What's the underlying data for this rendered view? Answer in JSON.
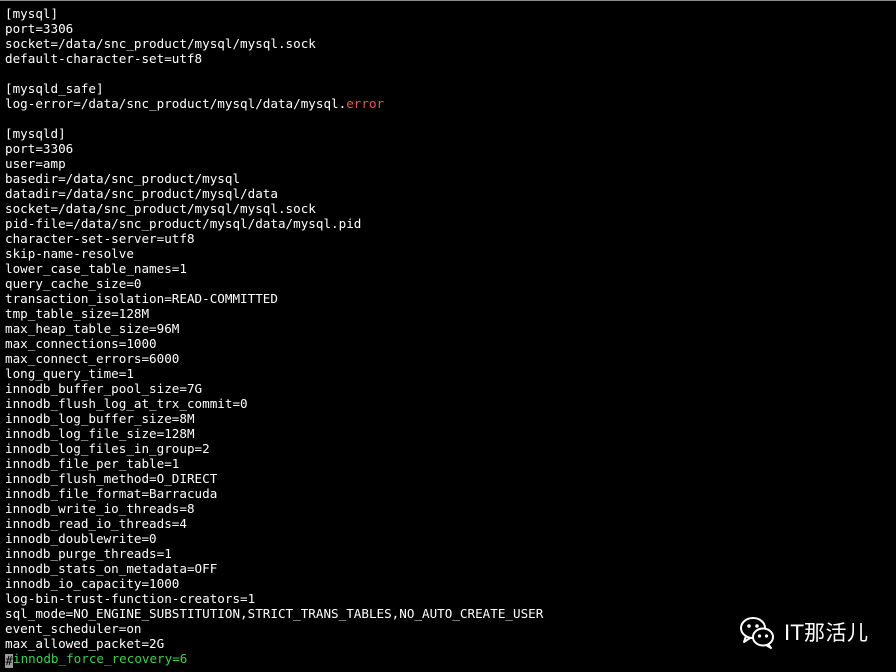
{
  "editor": {
    "lines": [
      "[mysql]",
      "port=3306",
      "socket=/data/snc_product/mysql/mysql.sock",
      "default-character-set=utf8",
      "",
      "[mysqld_safe]",
      "log-error=/data/snc_product/mysql/data/mysql.",
      "",
      "[mysqld]",
      "port=3306",
      "user=amp",
      "basedir=/data/snc_product/mysql",
      "datadir=/data/snc_product/mysql/data",
      "socket=/data/snc_product/mysql/mysql.sock",
      "pid-file=/data/snc_product/mysql/data/mysql.pid",
      "character-set-server=utf8",
      "skip-name-resolve",
      "lower_case_table_names=1",
      "query_cache_size=0",
      "transaction_isolation=READ-COMMITTED",
      "tmp_table_size=128M",
      "max_heap_table_size=96M",
      "max_connections=1000",
      "max_connect_errors=6000",
      "long_query_time=1",
      "innodb_buffer_pool_size=7G",
      "innodb_flush_log_at_trx_commit=0",
      "innodb_log_buffer_size=8M",
      "innodb_log_file_size=128M",
      "innodb_log_files_in_group=2",
      "innodb_file_per_table=1",
      "innodb_flush_method=O_DIRECT",
      "innodb_file_format=Barracuda",
      "innodb_write_io_threads=8",
      "innodb_read_io_threads=4",
      "innodb_doublewrite=0",
      "innodb_purge_threads=1",
      "innodb_stats_on_metadata=OFF",
      "innodb_io_capacity=1000",
      "log-bin-trust-function-creators=1",
      "sql_mode=NO_ENGINE_SUBSTITUTION,STRICT_TRANS_TABLES,NO_AUTO_CREATE_USER",
      "event_scheduler=on",
      "max_allowed_packet=2G",
      "innodb_force_recovery=6"
    ],
    "highlight_word": "error",
    "cursor_char": "#",
    "colors": {
      "background": "#000000",
      "text": "#ffffff",
      "highlight": "#e05a4a",
      "comment": "#3ad14f",
      "cursor": "#9a9a9a"
    }
  },
  "watermark": {
    "text": "IT那活儿",
    "icon": "wechat-icon"
  }
}
